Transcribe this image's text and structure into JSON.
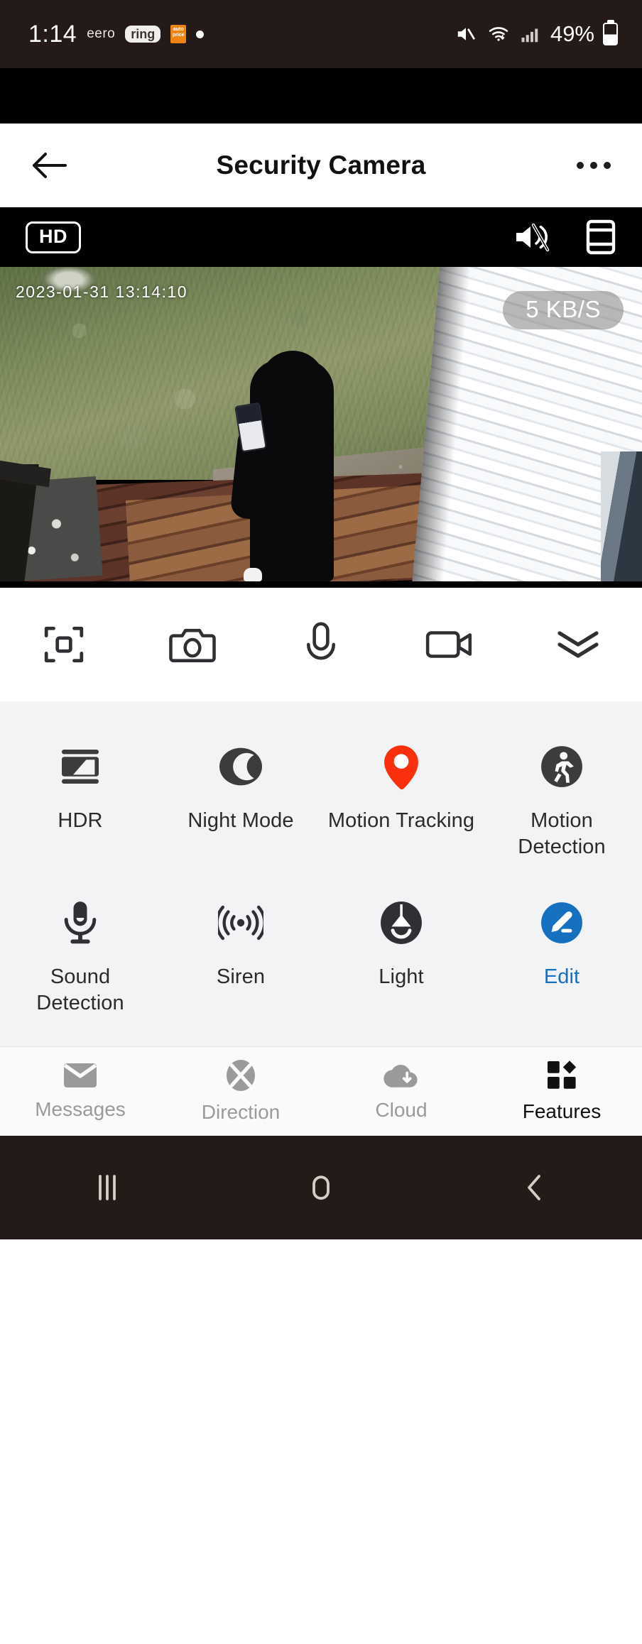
{
  "status_bar": {
    "time": "1:14",
    "carrier": "eero",
    "app_badge_ring": "ring",
    "app_badge_orange": "auto price",
    "battery_percent": "49%",
    "icons": [
      "mute-icon",
      "wifi-icon",
      "cellular-signal-icon",
      "battery-icon"
    ]
  },
  "app_bar": {
    "title": "Security Camera",
    "back_icon": "back-arrow-icon",
    "overflow_icon": "more-options-icon"
  },
  "player": {
    "quality_badge": "HD",
    "mute_icon": "speaker-mute-icon",
    "layout_icon": "split-view-icon",
    "timestamp": "2023-01-31  13:14:10",
    "bandwidth": "5 KB/S"
  },
  "toolbar": {
    "items": [
      {
        "name": "fullscreen-zoom-icon",
        "label": "Zoom"
      },
      {
        "name": "snapshot-camera-icon",
        "label": "Snapshot"
      },
      {
        "name": "microphone-talk-icon",
        "label": "Talk"
      },
      {
        "name": "record-video-icon",
        "label": "Record"
      },
      {
        "name": "collapse-chevrons-icon",
        "label": "Collapse"
      }
    ]
  },
  "features": {
    "rows": [
      [
        {
          "label": "HDR",
          "icon": "hdr-icon",
          "accent": false
        },
        {
          "label": "Night Mode",
          "icon": "night-mode-moon-icon",
          "accent": false
        },
        {
          "label": "Motion Tracking",
          "icon": "motion-tracking-pin-icon",
          "accent": false
        },
        {
          "label": "Motion Detection",
          "icon": "motion-detection-walking-icon",
          "accent": false
        }
      ],
      [
        {
          "label": "Sound Detection",
          "icon": "sound-detection-mic-icon",
          "accent": false
        },
        {
          "label": "Siren",
          "icon": "siren-waves-icon",
          "accent": false
        },
        {
          "label": "Light",
          "icon": "light-lamp-icon",
          "accent": false
        },
        {
          "label": "Edit",
          "icon": "edit-pencil-icon",
          "accent": true
        }
      ]
    ],
    "accent_color": "#1570c0",
    "motion_tracking_color": "#f9300b"
  },
  "bottom_nav": {
    "items": [
      {
        "label": "Messages",
        "icon": "envelope-icon",
        "active": false
      },
      {
        "label": "Direction",
        "icon": "direction-pad-icon",
        "active": false
      },
      {
        "label": "Cloud",
        "icon": "cloud-download-icon",
        "active": false
      },
      {
        "label": "Features",
        "icon": "features-grid-icon",
        "active": true
      }
    ]
  },
  "android_nav": {
    "recents_icon": "recents-icon",
    "home_icon": "home-icon",
    "back_icon": "android-back-icon"
  }
}
